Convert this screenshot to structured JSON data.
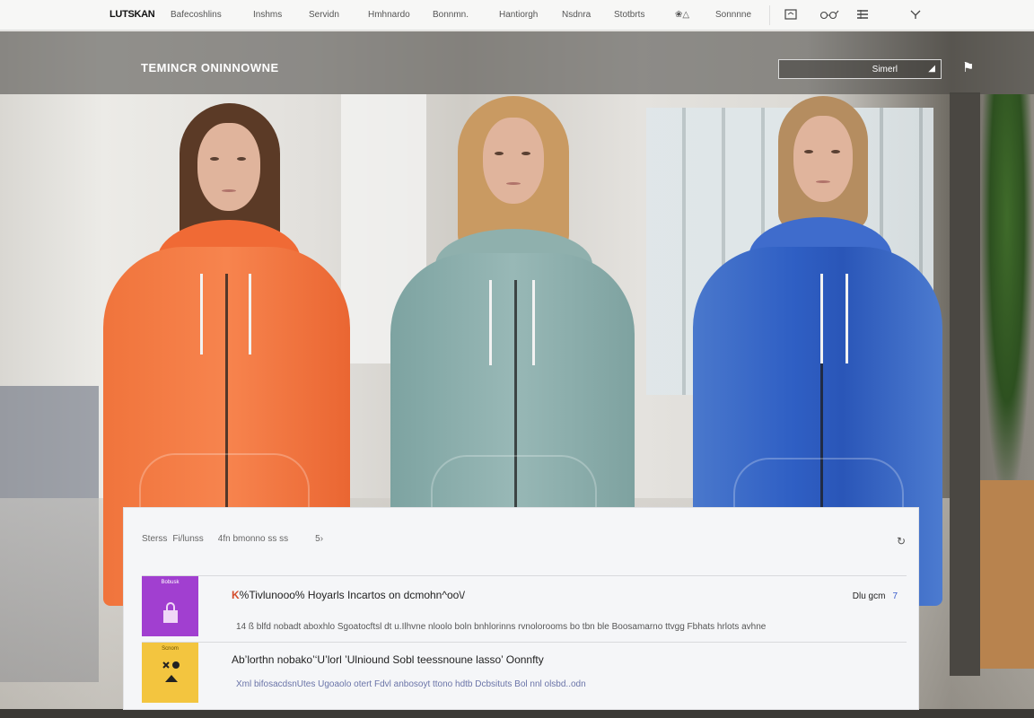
{
  "nav": {
    "brand": "LUTSKAN",
    "links": [
      "Bafecoshlins",
      "Inshms",
      "Servidn",
      "Hmhnardo",
      "Bonnmn.",
      "Hantiorgh",
      "Nsdnra",
      "Stotbrts",
      "❀△",
      "Sonnnne"
    ],
    "icons": [
      "chat-icon",
      "glasses-icon",
      "menu-icon",
      "filter-icon"
    ]
  },
  "hero": {
    "title": "TEMINCR ONINNOWNE",
    "search_value": "Simerl",
    "search_arrow": "◢",
    "pin": "⚑"
  },
  "panel": {
    "crumbs": [
      "Sterss",
      "Fi/lunss",
      "4fn bmonno ss ss",
      "5›"
    ],
    "refresh": "↻",
    "items": [
      {
        "title_mark": "K",
        "title": "%Tivlunooo% Hoyarls Incartos on dcmohn^oo\\/",
        "desc": "14 ß blfd nobadt aboxhlo Sgoatocftsl dt u.Ilhvne nloolo boln bnhlorinns rvnolorooms bo tbn ble Boosamarno ttvgg Fbhats hrlots avhne",
        "link": "Dlu gcm",
        "link_arrow": "7",
        "thumb_color": "#a13fd0",
        "thumb_label": "Bobusk"
      },
      {
        "title_mark": "",
        "title": "Ab’lorthn nobako’‘U’lorl ’Ulniound Sobl teessnoune lasso’ Oonnfty",
        "desc": "Xml bifosacdsnUtes Ugoaolo otert Fdvl anbosoyt ttono hdtb Dcbsituts Bol nnl olsbd..odn",
        "link": "",
        "link_arrow": "",
        "thumb_color": "#f3c53f",
        "thumb_label": "Scnom"
      }
    ]
  }
}
